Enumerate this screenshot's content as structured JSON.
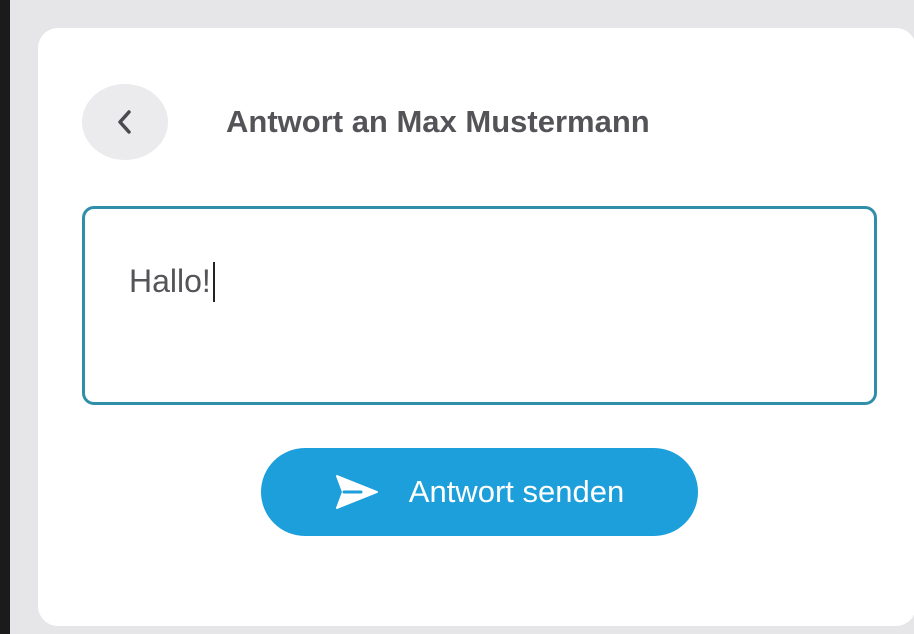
{
  "dialog": {
    "title": "Antwort an Max Mustermann",
    "back_icon": "chevron-left-icon"
  },
  "reply": {
    "value": "Hallo!"
  },
  "send_button": {
    "label": "Antwort senden",
    "icon": "send-icon"
  },
  "colors": {
    "accent": "#1d9fdc",
    "input_border": "#2f8fa9",
    "title_text": "#545458",
    "back_button_bg": "#ebebee",
    "card_bg": "#ffffff"
  }
}
